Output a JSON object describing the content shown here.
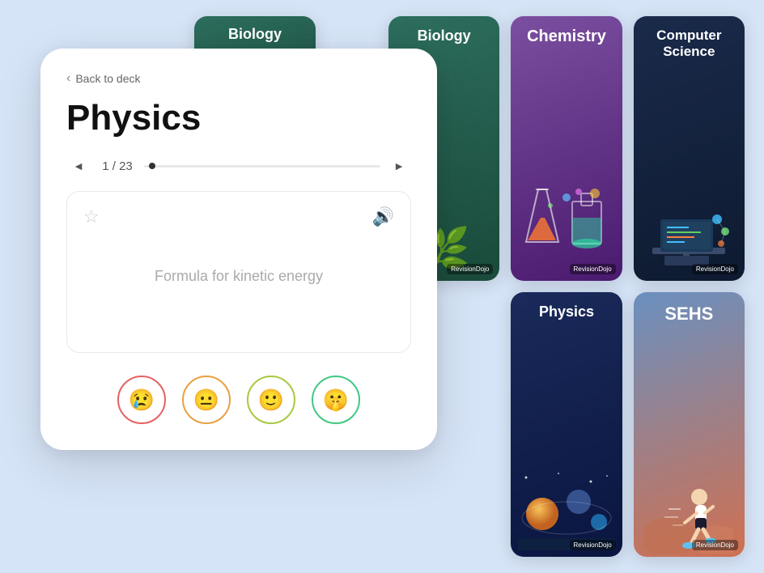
{
  "app": {
    "title": "RevisionDojo",
    "background_color": "#d6e4f7"
  },
  "back_link": {
    "label": "Back to deck",
    "chevron": "‹"
  },
  "subject_title": "Physics",
  "card_counter": {
    "current": 1,
    "total": 23,
    "display": "1 / 23"
  },
  "flashcard": {
    "question": "Formula for kinetic energy",
    "is_starred": false
  },
  "nav": {
    "prev_label": "◄",
    "next_label": "►"
  },
  "reactions": [
    {
      "emoji": "😢",
      "color_class": "red"
    },
    {
      "emoji": "😐",
      "color_class": "orange"
    },
    {
      "emoji": "🙂",
      "color_class": "yellow-green"
    },
    {
      "emoji": "🤫",
      "color_class": "green"
    }
  ],
  "subject_cards": [
    {
      "id": "biology",
      "title": "Biology",
      "art": "🌿",
      "bg_from": "#2d6e5e",
      "bg_to": "#1a4a3a",
      "row": 1,
      "col": 1
    },
    {
      "id": "chemistry",
      "title": "Chemistry",
      "art": "⚗️",
      "bg_from": "#7b4fa0",
      "bg_to": "#4a1a6e",
      "row": 1,
      "col": 2
    },
    {
      "id": "computer-science",
      "title": "Computer Science",
      "art": "💻",
      "bg_from": "#1a2a4a",
      "bg_to": "#0d1a30",
      "row": 1,
      "col": 3
    },
    {
      "id": "physics2",
      "title": "Physics",
      "art": "🔭",
      "bg_from": "#1a2a5a",
      "bg_to": "#0a1540",
      "row": 2,
      "col": 2
    },
    {
      "id": "sehs",
      "title": "SEHS",
      "art": "🏃",
      "bg_from": "#5a7ab0",
      "bg_to": "#c87a50",
      "row": 2,
      "col": 3
    }
  ],
  "brand": "RevisionDojo"
}
